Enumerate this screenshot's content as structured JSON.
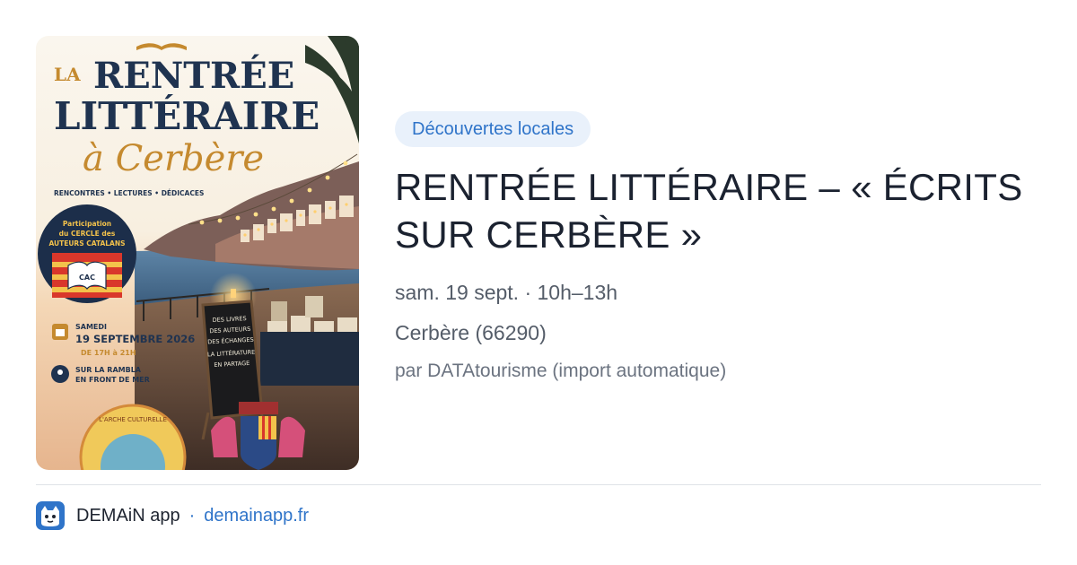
{
  "event": {
    "category_tag": "Découvertes locales",
    "title": "RENTRÉE LITTÉRAIRE – « ÉCRITS SUR CERBÈRE »",
    "date_time": "sam. 19 sept. · 10h–13h",
    "location": "Cerbère (66290)",
    "source": "par DATAtourisme (import automatique)"
  },
  "poster": {
    "line_la": "LA",
    "line_rentree": "RENTRÉE",
    "line_litteraire": "LITTÉRAIRE",
    "line_script": "à Cerbère",
    "subtitle": "RENCONTRES • LECTURES • DÉDICACES",
    "badge_line1": "Participation",
    "badge_line2": "du CERCLE des",
    "badge_line3": "AUTEURS CATALANS",
    "badge_logo_text": "CAC",
    "day": "SAMEDI",
    "date": "19 SEPTEMBRE 2026",
    "hours": "DE 17H à 21H",
    "place_line1": "SUR LA RAMBLA",
    "place_line2": "EN FRONT DE MER",
    "board_line1": "DES LIVRES",
    "board_line2": "DES AUTEURS",
    "board_line3": "DES ÉCHANGES",
    "board_line4": "LA LITTÉRATURE",
    "board_line5": "EN PARTAGE",
    "seal_text": "L'ARCHE CULTURELLE"
  },
  "footer": {
    "app_name": "DEMAiN app",
    "separator": "·",
    "domain": "demainapp.fr"
  },
  "colors": {
    "accent": "#2f74c9",
    "tag_background": "#e9f1fb",
    "poster_navy": "#1f3350",
    "poster_gold": "#c58a2f"
  },
  "icons": {
    "calendar": "calendar-icon",
    "location": "location-pin-icon",
    "app": "demain-app-icon"
  }
}
